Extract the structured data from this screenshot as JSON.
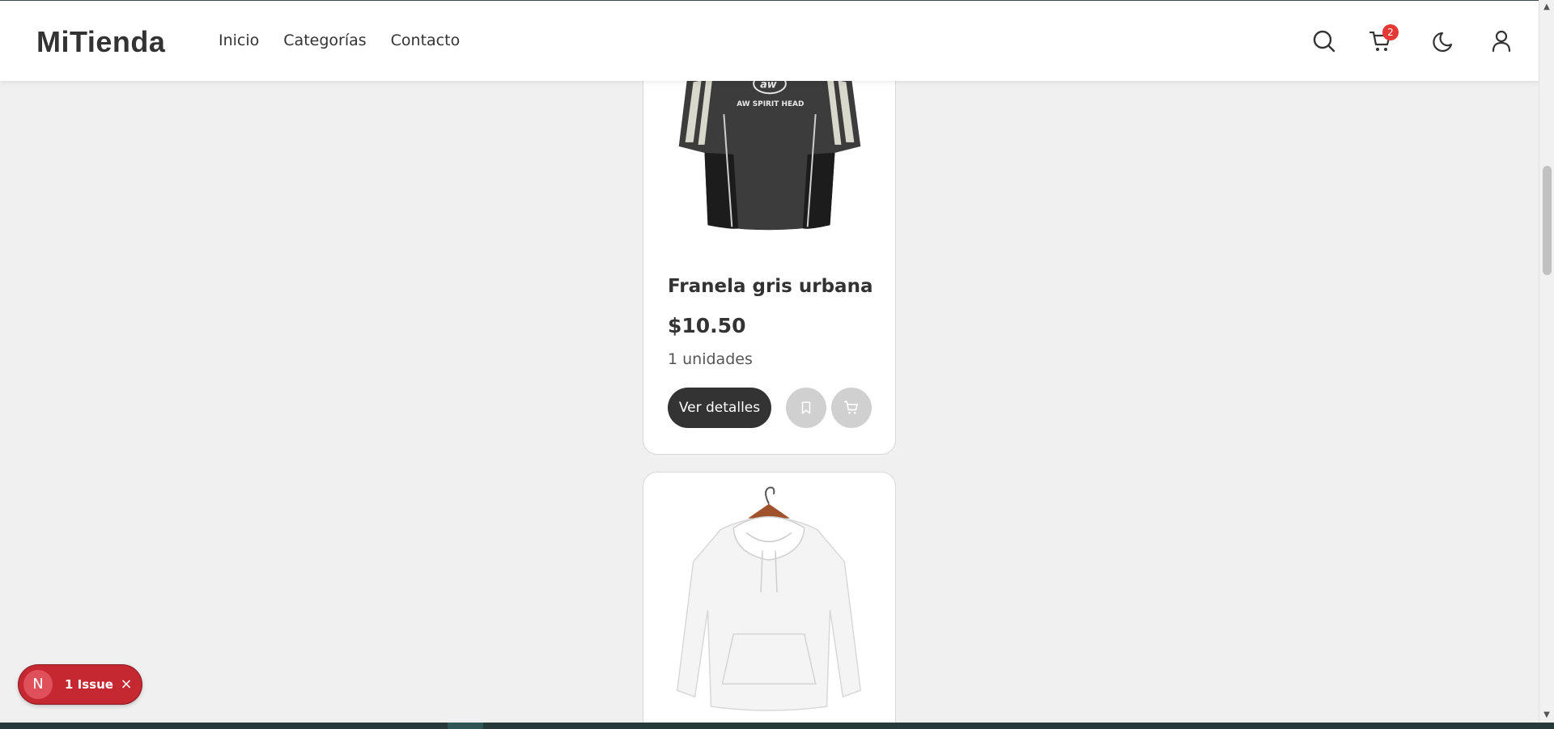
{
  "header": {
    "brand": "MiTienda",
    "nav": [
      {
        "label": "Inicio"
      },
      {
        "label": "Categorías"
      },
      {
        "label": "Contacto"
      }
    ],
    "cart_count": "2",
    "icons": [
      "search-icon",
      "cart-icon",
      "moon-icon",
      "user-icon"
    ]
  },
  "products": [
    {
      "name": "Franela gris urbana",
      "price": "$10.50",
      "units": "1 unidades",
      "details_label": "Ver detalles",
      "image": "gray-jersey-shirt",
      "shirt_print": "AW SPIRIT HEAD"
    },
    {
      "image": "white-hoodie-on-hanger"
    }
  ],
  "issue_indicator": {
    "logo": "N",
    "label": "1 Issue",
    "close": "×"
  },
  "colors": {
    "badge": "#e53935",
    "issue_pill": "#c62832",
    "button_dark": "#333333",
    "button_round": "#d0d0d0",
    "page_bg": "#f0f0f0"
  }
}
